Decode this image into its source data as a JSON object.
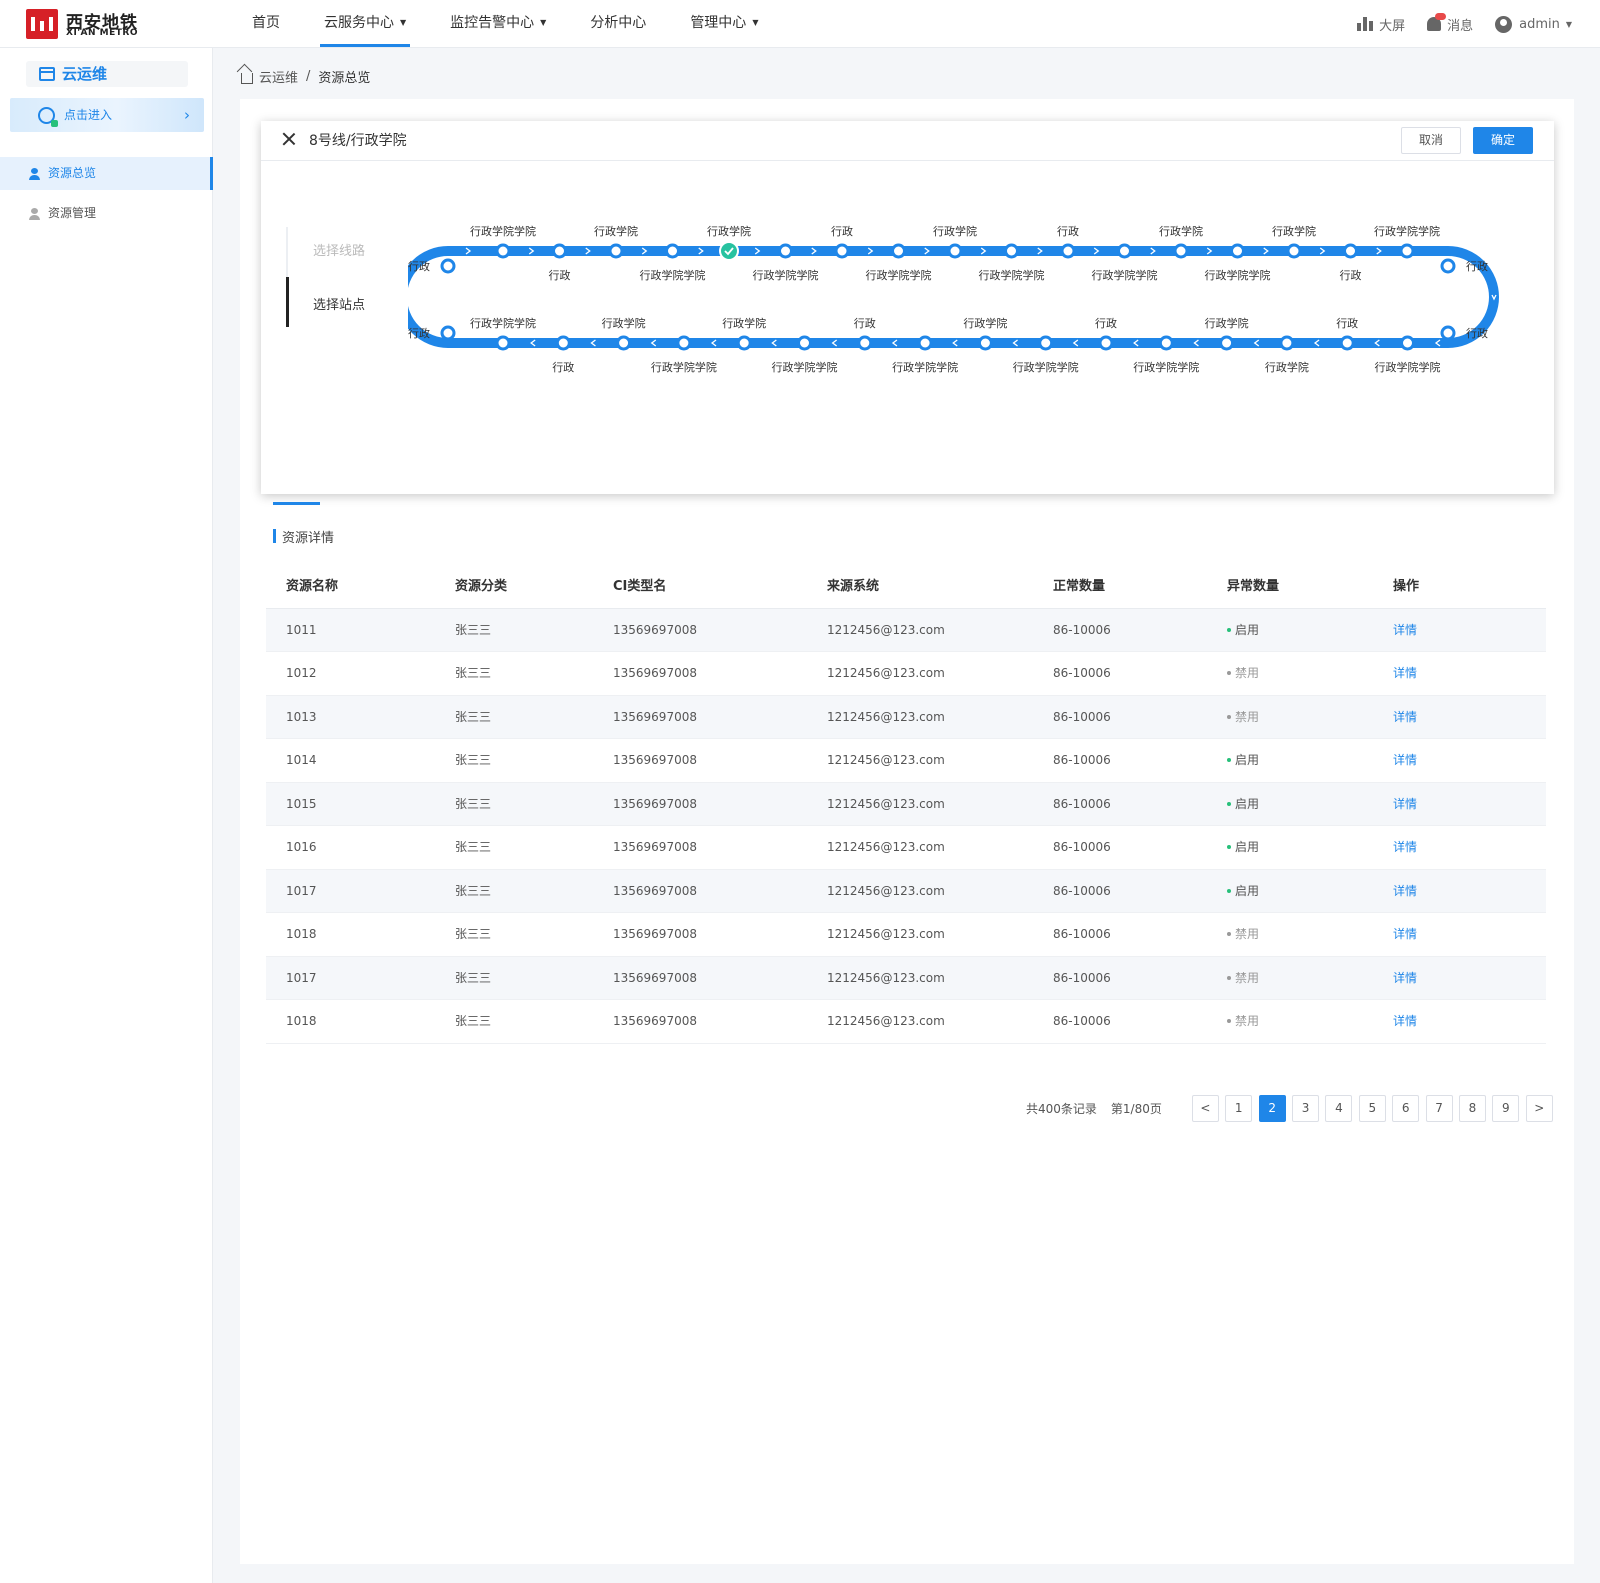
{
  "brand": {
    "name_cn": "西安地铁",
    "name_en": "XI'AN METRO",
    "color": "#d62027"
  },
  "nav": [
    {
      "label": "首页",
      "dropdown": false,
      "active": false
    },
    {
      "label": "云服务中心",
      "dropdown": true,
      "active": true
    },
    {
      "label": "监控告警中心",
      "dropdown": true,
      "active": false
    },
    {
      "label": "分析中心",
      "dropdown": false,
      "active": false
    },
    {
      "label": "管理中心",
      "dropdown": true,
      "active": false
    }
  ],
  "topright": {
    "screen_label": "大屏",
    "message_label": "消息",
    "user_label": "admin"
  },
  "sidebar": {
    "title": "云运维",
    "enter_label": "点击进入",
    "items": [
      {
        "label": "资源总览",
        "active": true
      },
      {
        "label": "资源管理",
        "active": false
      }
    ]
  },
  "breadcrumb": {
    "root": "云运维",
    "sep": "/",
    "current": "资源总览"
  },
  "dialog": {
    "title": "8号线/行政学院",
    "cancel_label": "取消",
    "confirm_label": "确定",
    "steps": [
      "选择线路",
      "选择站点"
    ],
    "line_color": "#1f86e8",
    "selected_color": "#27c2a0",
    "end_labels": {
      "top_left": "行政",
      "bottom_left": "行政",
      "top_right": "行政",
      "bottom_right": "行政"
    },
    "top_row": [
      {
        "label": "行政学院学院",
        "pos": "above"
      },
      {
        "label": "行政",
        "pos": "below"
      },
      {
        "label": "行政学院",
        "pos": "above"
      },
      {
        "label": "行政学院学院",
        "pos": "below"
      },
      {
        "label": "行政学院",
        "pos": "above",
        "selected": true
      },
      {
        "label": "行政学院学院",
        "pos": "below"
      },
      {
        "label": "行政",
        "pos": "above"
      },
      {
        "label": "行政学院学院",
        "pos": "below"
      },
      {
        "label": "行政学院",
        "pos": "above"
      },
      {
        "label": "行政学院学院",
        "pos": "below"
      },
      {
        "label": "行政",
        "pos": "above"
      },
      {
        "label": "行政学院学院",
        "pos": "below"
      },
      {
        "label": "行政学院",
        "pos": "above"
      },
      {
        "label": "行政学院学院",
        "pos": "below"
      },
      {
        "label": "行政学院",
        "pos": "above"
      },
      {
        "label": "行政",
        "pos": "below"
      },
      {
        "label": "行政学院学院",
        "pos": "above"
      }
    ],
    "bottom_row": [
      {
        "label": "行政学院学院",
        "pos": "above"
      },
      {
        "label": "行政",
        "pos": "below"
      },
      {
        "label": "行政学院",
        "pos": "above"
      },
      {
        "label": "行政学院学院",
        "pos": "below"
      },
      {
        "label": "行政学院",
        "pos": "above"
      },
      {
        "label": "行政学院学院",
        "pos": "below"
      },
      {
        "label": "行政",
        "pos": "above"
      },
      {
        "label": "行政学院学院",
        "pos": "below"
      },
      {
        "label": "行政学院",
        "pos": "above"
      },
      {
        "label": "行政学院学院",
        "pos": "below"
      },
      {
        "label": "行政",
        "pos": "above"
      },
      {
        "label": "行政学院学院",
        "pos": "below"
      },
      {
        "label": "行政学院",
        "pos": "above"
      },
      {
        "label": "行政学院",
        "pos": "below"
      },
      {
        "label": "行政",
        "pos": "above"
      },
      {
        "label": "行政学院学院",
        "pos": "below"
      }
    ]
  },
  "section_title": "资源详情",
  "table": {
    "headers": [
      "资源名称",
      "资源分类",
      "CI类型名",
      "来源系统",
      "正常数量",
      "异常数量",
      "操作"
    ],
    "rows": [
      {
        "name": "1011",
        "category": "张三三",
        "ci": "13569697008",
        "source": "1212456@123.com",
        "normal": "86-10006",
        "status": "启用",
        "enabled": true,
        "action": "详情"
      },
      {
        "name": "1012",
        "category": "张三三",
        "ci": "13569697008",
        "source": "1212456@123.com",
        "normal": "86-10006",
        "status": "禁用",
        "enabled": false,
        "action": "详情"
      },
      {
        "name": "1013",
        "category": "张三三",
        "ci": "13569697008",
        "source": "1212456@123.com",
        "normal": "86-10006",
        "status": "禁用",
        "enabled": false,
        "action": "详情"
      },
      {
        "name": "1014",
        "category": "张三三",
        "ci": "13569697008",
        "source": "1212456@123.com",
        "normal": "86-10006",
        "status": "启用",
        "enabled": true,
        "action": "详情"
      },
      {
        "name": "1015",
        "category": "张三三",
        "ci": "13569697008",
        "source": "1212456@123.com",
        "normal": "86-10006",
        "status": "启用",
        "enabled": true,
        "action": "详情"
      },
      {
        "name": "1016",
        "category": "张三三",
        "ci": "13569697008",
        "source": "1212456@123.com",
        "normal": "86-10006",
        "status": "启用",
        "enabled": true,
        "action": "详情"
      },
      {
        "name": "1017",
        "category": "张三三",
        "ci": "13569697008",
        "source": "1212456@123.com",
        "normal": "86-10006",
        "status": "启用",
        "enabled": true,
        "action": "详情"
      },
      {
        "name": "1018",
        "category": "张三三",
        "ci": "13569697008",
        "source": "1212456@123.com",
        "normal": "86-10006",
        "status": "禁用",
        "enabled": false,
        "action": "详情"
      },
      {
        "name": "1017",
        "category": "张三三",
        "ci": "13569697008",
        "source": "1212456@123.com",
        "normal": "86-10006",
        "status": "禁用",
        "enabled": false,
        "action": "详情"
      },
      {
        "name": "1018",
        "category": "张三三",
        "ci": "13569697008",
        "source": "1212456@123.com",
        "normal": "86-10006",
        "status": "禁用",
        "enabled": false,
        "action": "详情"
      }
    ]
  },
  "pagination": {
    "total_text": "共400条记录",
    "page_text": "第1/80页",
    "prev": "<",
    "next": ">",
    "pages": [
      "1",
      "2",
      "3",
      "4",
      "5",
      "6",
      "7",
      "8",
      "9"
    ],
    "current": "2"
  }
}
